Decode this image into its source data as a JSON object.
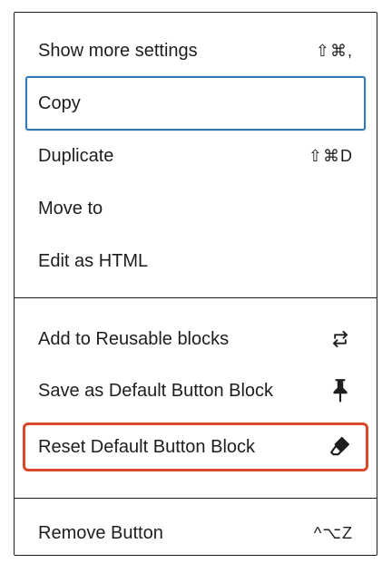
{
  "menu": {
    "items": [
      {
        "label": "Show more settings",
        "shortcut": "⇧⌘,"
      },
      {
        "label": "Copy",
        "shortcut": ""
      },
      {
        "label": "Duplicate",
        "shortcut": "⇧⌘D"
      },
      {
        "label": "Move to",
        "shortcut": ""
      },
      {
        "label": "Edit as HTML",
        "shortcut": ""
      },
      {
        "label": "Add to Reusable blocks",
        "icon": "reusable-blocks-icon"
      },
      {
        "label": "Save as Default Button Block",
        "icon": "pin-icon"
      },
      {
        "label": "Reset Default Button Block",
        "icon": "eraser-icon"
      },
      {
        "label": "Remove Button",
        "shortcut": "^⌥Z"
      }
    ]
  },
  "colors": {
    "focus_border": "#3379b5",
    "highlight_border": "#d9472b",
    "text": "#1e1e1e"
  }
}
